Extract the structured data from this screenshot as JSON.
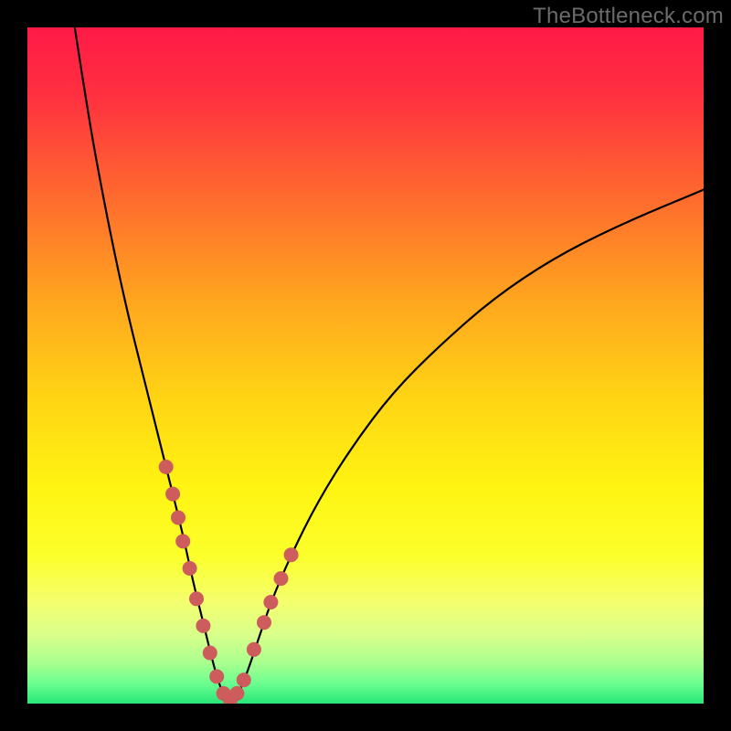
{
  "watermark": "TheBottleneck.com",
  "chart_data": {
    "type": "line",
    "title": "",
    "xlabel": "",
    "ylabel": "",
    "xlim": [
      0,
      100
    ],
    "ylim": [
      0,
      100
    ],
    "background_gradient_stops": [
      {
        "offset": 0.0,
        "color": "#ff1a46"
      },
      {
        "offset": 0.1,
        "color": "#ff3040"
      },
      {
        "offset": 0.25,
        "color": "#ff6a2e"
      },
      {
        "offset": 0.4,
        "color": "#ffa41f"
      },
      {
        "offset": 0.55,
        "color": "#ffd514"
      },
      {
        "offset": 0.68,
        "color": "#fff412"
      },
      {
        "offset": 0.78,
        "color": "#fcff2a"
      },
      {
        "offset": 0.85,
        "color": "#f4ff6e"
      },
      {
        "offset": 0.9,
        "color": "#d8ff8c"
      },
      {
        "offset": 0.94,
        "color": "#a8ff8e"
      },
      {
        "offset": 0.97,
        "color": "#6bff90"
      },
      {
        "offset": 1.0,
        "color": "#28e67a"
      }
    ],
    "series": [
      {
        "name": "bottleneck-curve",
        "color": "#000000",
        "x": [
          7,
          9,
          11,
          13,
          15,
          17,
          19,
          21,
          23,
          24.5,
          26,
          27.2,
          28.3,
          29.2,
          30,
          31,
          32.3,
          34,
          36,
          39,
          43,
          48,
          54,
          61,
          69,
          78,
          88,
          100
        ],
        "y": [
          100,
          87,
          76,
          66,
          57,
          49,
          41,
          33,
          25,
          18,
          12,
          7,
          3,
          1,
          0,
          1,
          4,
          9,
          15,
          22,
          30,
          38,
          46,
          53,
          60,
          66,
          71,
          76
        ]
      }
    ],
    "markers": {
      "name": "highlight-dots",
      "color": "#cd5c5c",
      "radius": 8,
      "x": [
        20.5,
        21.5,
        22.3,
        23.0,
        24.0,
        25.0,
        26.0,
        27.0,
        28.0,
        29.0,
        30.0,
        31.0,
        32.0,
        33.5,
        35.0,
        36.0,
        37.5,
        39.0
      ],
      "y": [
        35,
        31,
        27.5,
        24,
        20,
        15.5,
        11.5,
        7.5,
        4,
        1.5,
        0.5,
        1.5,
        3.5,
        8,
        12,
        15,
        18.5,
        22
      ]
    }
  }
}
